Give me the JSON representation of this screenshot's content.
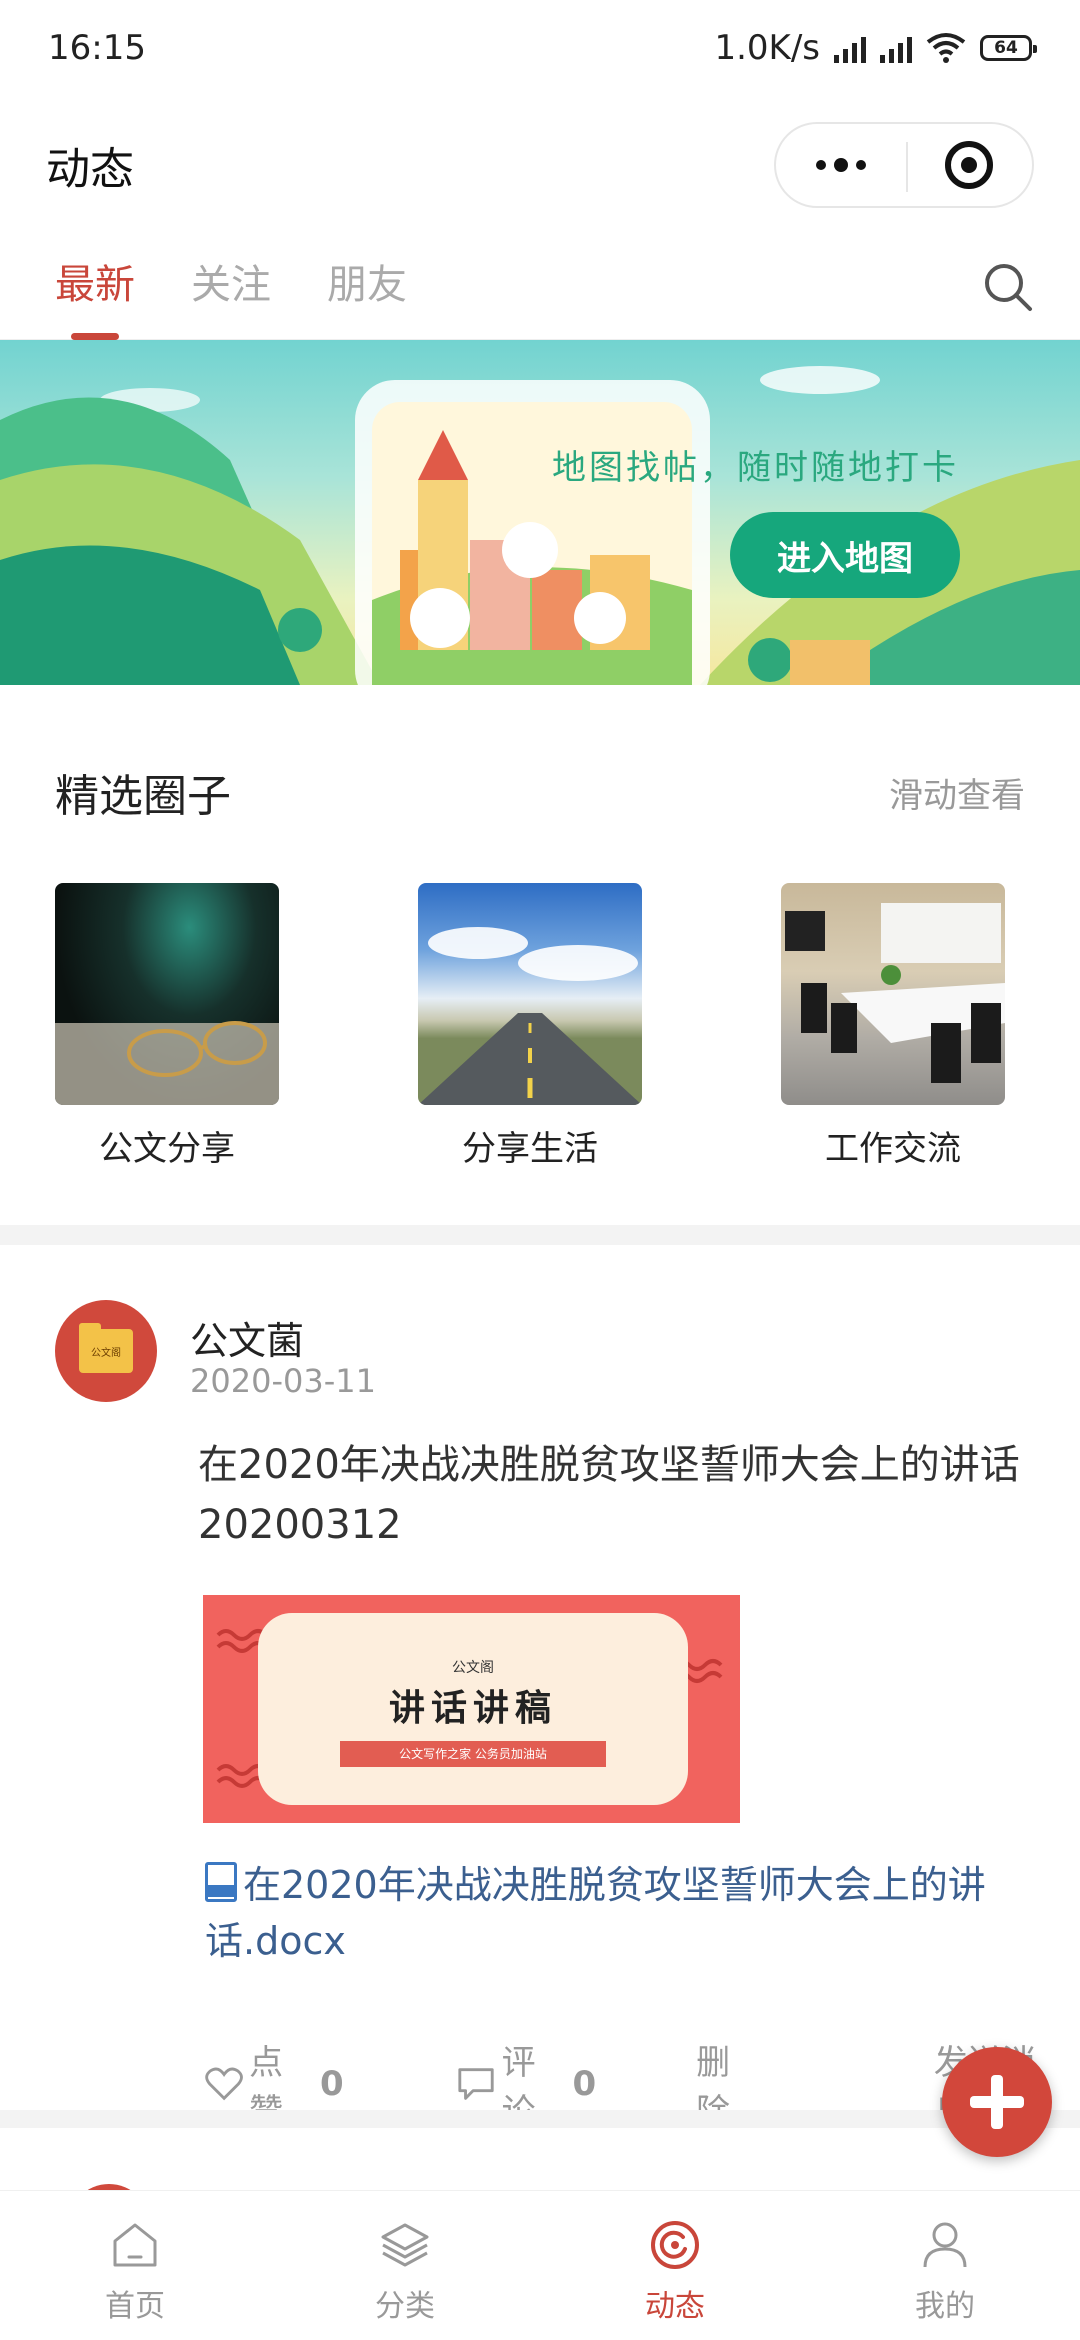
{
  "status_bar": {
    "time": "16:15",
    "net_speed": "1.0K/s",
    "battery": "64"
  },
  "header": {
    "title": "动态"
  },
  "tabs": [
    {
      "label": "最新",
      "active": true
    },
    {
      "label": "关注",
      "active": false
    },
    {
      "label": "朋友",
      "active": false
    }
  ],
  "banner": {
    "tagline": "地图找帖，随时随地打卡",
    "button_label": "进入地图"
  },
  "featured": {
    "title": "精选圈子",
    "hint": "滑动查看",
    "circles": [
      {
        "label": "公文分享",
        "image": "glasses-on-newspaper"
      },
      {
        "label": "分享生活",
        "image": "open-road-sky"
      },
      {
        "label": "工作交流",
        "image": "meeting-room"
      }
    ]
  },
  "post": {
    "author": "公文菌",
    "avatar_text": "公文阁",
    "date": "2020-03-11",
    "title": "在2020年决战决胜脱贫攻坚誓师大会上的讲话20200312",
    "image": {
      "small_text": "公文阁",
      "main_text": "讲话讲稿",
      "ribbon_text": "公文写作之家  公务员加油站"
    },
    "file_name": "在2020年决战决胜脱贫攻坚誓师大会上的讲话.docx",
    "doc_badge": "DOCX",
    "actions": {
      "like_label": "点赞",
      "like_count": "0",
      "comment_label": "评论",
      "comment_count": "0",
      "delete_label": "删除",
      "message_label": "发送消息"
    }
  },
  "bottom_nav": [
    {
      "label": "首页",
      "icon": "home-icon",
      "active": false
    },
    {
      "label": "分类",
      "icon": "layers-icon",
      "active": false
    },
    {
      "label": "动态",
      "icon": "activity-icon",
      "active": true
    },
    {
      "label": "我的",
      "icon": "user-icon",
      "active": false
    }
  ],
  "colors": {
    "accent": "#c9463a",
    "link": "#3b5f8f",
    "banner_button": "#16a77c"
  }
}
